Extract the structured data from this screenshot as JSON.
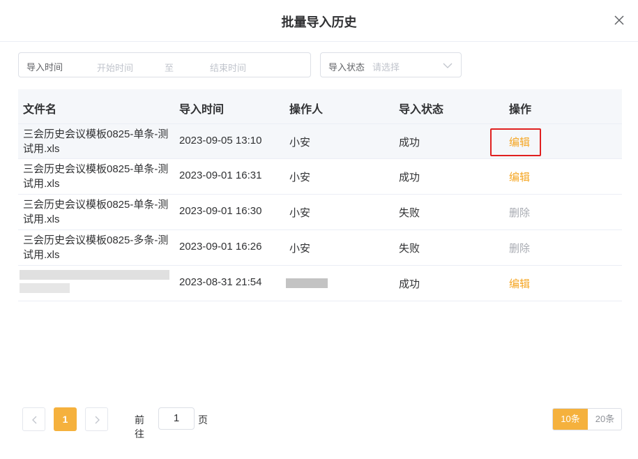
{
  "dialog": {
    "title": "批量导入历史"
  },
  "filters": {
    "date_label": "导入时间",
    "start_placeholder": "开始时间",
    "range_separator": "至",
    "end_placeholder": "结束时间",
    "status_label": "导入状态",
    "status_placeholder": "请选择"
  },
  "table": {
    "headers": [
      "文件名",
      "导入时间",
      "操作人",
      "导入状态",
      "操作"
    ],
    "rows": [
      {
        "file": "三会历史会议模板0825-单条-测试用.xls",
        "time": "2023-09-05 13:10",
        "operator": "小安",
        "status": "成功",
        "action": "编辑"
      },
      {
        "file": "三会历史会议模板0825-单条-测试用.xls",
        "time": "2023-09-01 16:31",
        "operator": "小安",
        "status": "成功",
        "action": "编辑"
      },
      {
        "file": "三会历史会议模板0825-单条-测试用.xls",
        "time": "2023-09-01 16:30",
        "operator": "小安",
        "status": "失败",
        "action": "删除"
      },
      {
        "file": "三会历史会议模板0825-多条-测试用.xls",
        "time": "2023-09-01 16:26",
        "operator": "小安",
        "status": "失败",
        "action": "删除"
      },
      {
        "file": "",
        "time": "2023-08-31 21:54",
        "operator": "",
        "status": "成功",
        "action": "编辑"
      }
    ]
  },
  "pagination": {
    "current_page": "1",
    "goto_prefix": "前往",
    "goto_value": "1",
    "goto_suffix": "页",
    "size_options": [
      "10条",
      "20条"
    ],
    "selected_size": "10条"
  },
  "colors": {
    "accent": "#f5b13d",
    "edit_action": "#f5a623",
    "delete_action": "#a8abb2",
    "highlight": "#e02020"
  },
  "icons": [
    "close-icon",
    "chevron-down-icon",
    "chevron-left-icon",
    "chevron-right-icon"
  ]
}
